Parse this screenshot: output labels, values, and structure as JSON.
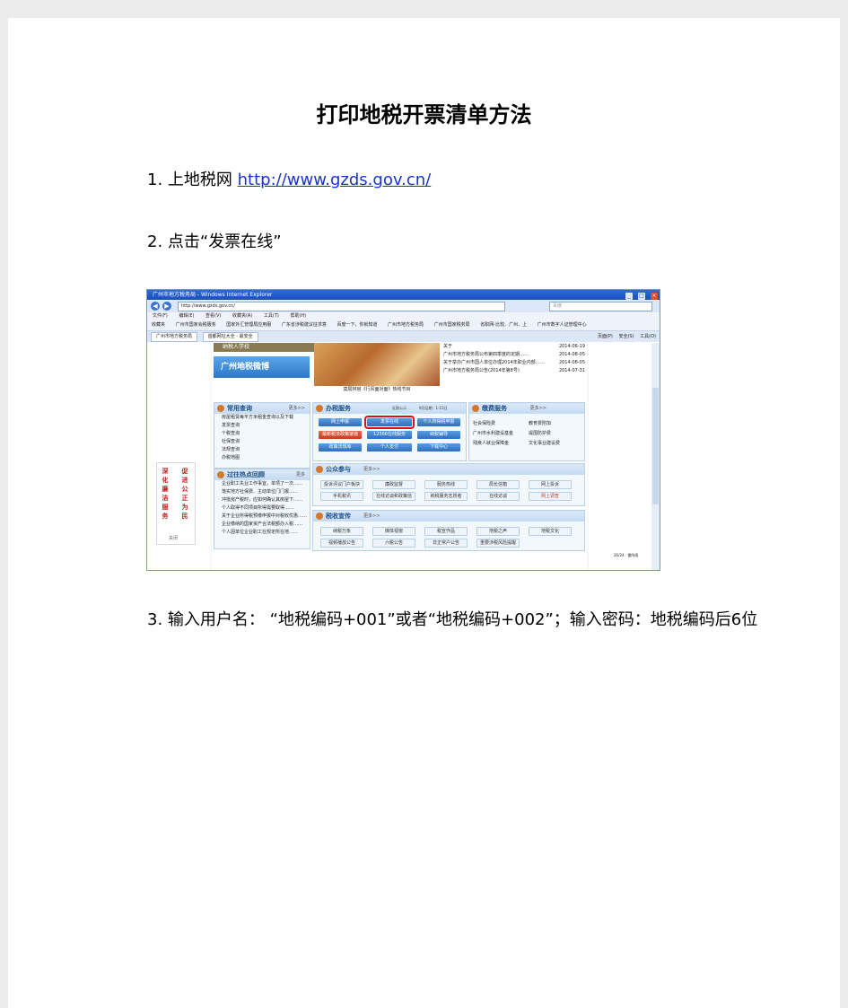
{
  "document": {
    "title": "打印地税开票清单方法",
    "step1": {
      "text": "1. 上地税网 ",
      "link": "http://www.gzds.gov.cn/"
    },
    "step2": "2. 点击“发票在线”",
    "step3": "3. 输入用户名：   “地税编码+001”或者“地税编码+002”；输入密码：地税编码后6位"
  },
  "screenshot": {
    "window_title": "广州市地方税务局 - Windows Internet Explorer",
    "url": "http://www.gzds.gov.cn/",
    "search_placeholder": "百度",
    "menu": [
      "文件(F)",
      "编辑(E)",
      "查看(V)",
      "收藏夹(A)",
      "工具(T)",
      "帮助(H)"
    ],
    "favorites": [
      "收藏夹",
      "广州市国家会税服务",
      "国家外汇管理局应用服",
      "广东省涉税建议征求意",
      "百度一下，你就知道",
      "广州市地方税务局",
      "广州市国家税务局",
      "省职网-比较、广州、上",
      "广州市数字人证管理中心"
    ],
    "tabs": [
      "广州市地方税务局",
      "首都网址大全 - 最安全"
    ],
    "toolbar_right": [
      "页面(P)",
      "安全(S)",
      "工具(O)"
    ],
    "banner_left": "纳税人学校",
    "weibo": "广州地税微博",
    "photo_caption": "莫局林官《行风面对面》热线节目",
    "news": [
      {
        "title": "关于",
        "date": "2014-06-19"
      },
      {
        "title": "广州市地方税务局公布第四季度的定期……",
        "date": "2014-08-05"
      },
      {
        "title": "关于举办广州市国人单位办理2014年职业内部……",
        "date": "2014-08-05"
      },
      {
        "title": "广州市地方税务局公告(2014年第8号)",
        "date": "2014-07-31"
      }
    ],
    "common_query": {
      "title": "常用查询",
      "more": "更多>>",
      "items": [
        "房屋租赁每平方米租金查询以及下载",
        "发票查询",
        "个税查询",
        "社保查询",
        "法规查询",
        "办税地图"
      ]
    },
    "hot_topics": {
      "title": "过往热点回顾",
      "more": "更多",
      "items": [
        "企业职工失业工作事宜，单项了一次……",
        "落实地方社保费、主动单位门门报……",
        "冲抵房产税时，应如何确认其房屋下……",
        "个人取得不同项目所得需要取得……",
        "关于企业所得税预缴申报中对税收优惠……",
        "企业缴纳的国家资产合法税额办入税……",
        "个人因单位企业职工在规定所在地……"
      ]
    },
    "tax_service": {
      "title": "办税服务",
      "more": "更多>>",
      "tags": [
        "证照公示",
        "9月征期：1-15日"
      ],
      "buttons": [
        "网上申报",
        "发票在线",
        "个人所得税申报",
        "最新税法政策速递",
        "12366在线服务",
        "纳税辅导",
        "政策法规库",
        "个人支付",
        "下载中心"
      ]
    },
    "payment": {
      "title": "缴费服务",
      "more": "更多>>",
      "items": [
        "社会保险费",
        "教育费附加",
        "广州市水利建设基金",
        "堤围防护费",
        "残疾人就业保障金",
        "文化事业建设费"
      ]
    },
    "public": {
      "title": "公众参与",
      "more": "更多>>",
      "buttons": [
        "投诉评议门户板块",
        "廉政监督",
        "服务热线",
        "局长信箱",
        "网上投诉",
        "手机税讯",
        "在线访谈和政策信",
        "纳税服务志愿者",
        "在线访谈",
        "网上调查"
      ]
    },
    "promo": {
      "title": "税收宣传",
      "more": "更多>>",
      "buttons": [
        "纳税万象",
        "媒体视窗",
        "税宣作品",
        "地税之声",
        "地税文化",
        "视频播放公告",
        "六税公告",
        "非正常户公告",
        "重要涉税风险提醒"
      ]
    },
    "slogan": [
      "深化廉洁服务",
      "促进公正为民"
    ],
    "slogan_close": "关闭",
    "weather": "26/24 · 雷阵雨"
  }
}
